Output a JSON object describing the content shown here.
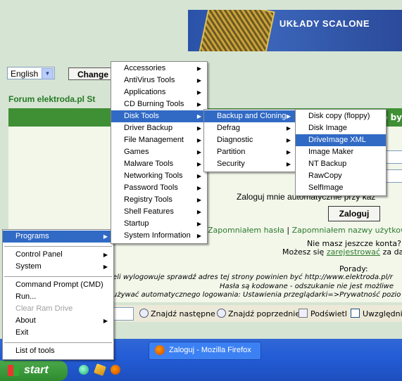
{
  "banner": {
    "text": "UKŁADY SCALONE"
  },
  "language": {
    "value": "English",
    "change_label": "Change"
  },
  "forum": {
    "title": "Forum elektroda.pl St",
    "bar_end": "o by",
    "auto_login": "Zaloguj mnie automatycznie przy każ",
    "login_button": "Zaloguj",
    "forgot_password": "Zapomniałem hasła",
    "separator": "|",
    "forgot_username": "Zapomniałem nazwy użytkow",
    "no_account": "Nie masz jeszcze konta?",
    "register_pre": "Możesz się",
    "register_link": "zarejestrować",
    "register_post": "za da",
    "tips_title": "Porady:",
    "tip1": "eli wylogowuje sprawdź adres tej strony powinien być http://www.elektroda.pl/r",
    "tip2": "Hasła są kodowane - odszukanie nie jest możliwe",
    "tip3": "używać automatycznego logowania: Ustawienia przeglądarki=>Prywatność pozio"
  },
  "findbar": {
    "next": "Znajdź następne",
    "prev": "Znajdź poprzednie",
    "highlight": "Podświetl",
    "match_case": "Uwzględnij"
  },
  "taskbar": {
    "start": "start",
    "window_title": "Zaloguj - Mozilla Firefox"
  },
  "menus": {
    "main": [
      {
        "label": "Programs",
        "arrow": "▶",
        "highlighted": true
      },
      {
        "label": "Control Panel",
        "arrow": "▶"
      },
      {
        "label": "System",
        "arrow": "▶"
      },
      {
        "label": "Command Prompt (CMD)"
      },
      {
        "label": "Run..."
      },
      {
        "label": "Clear Ram Drive",
        "disabled": true
      },
      {
        "label": "About",
        "arrow": "▶"
      },
      {
        "label": "Exit"
      },
      {
        "label": "List of tools"
      }
    ],
    "programs": [
      {
        "label": "Accessories",
        "arrow": "▶"
      },
      {
        "label": "AntiVirus Tools",
        "arrow": "▶"
      },
      {
        "label": "Applications",
        "arrow": "▶"
      },
      {
        "label": "CD Burning Tools",
        "arrow": "▶"
      },
      {
        "label": "Disk Tools",
        "arrow": "▶",
        "highlighted": true
      },
      {
        "label": "Driver Backup",
        "arrow": "▶"
      },
      {
        "label": "File Management",
        "arrow": "▶"
      },
      {
        "label": "Games",
        "arrow": "▶"
      },
      {
        "label": "Malware Tools",
        "arrow": "▶"
      },
      {
        "label": "Networking Tools",
        "arrow": "▶"
      },
      {
        "label": "Password Tools",
        "arrow": "▶"
      },
      {
        "label": "Registry Tools",
        "arrow": "▶"
      },
      {
        "label": "Shell Features",
        "arrow": "▶"
      },
      {
        "label": "Startup",
        "arrow": "▶"
      },
      {
        "label": "System Information",
        "arrow": "▶"
      }
    ],
    "disk_tools": [
      {
        "label": "Backup and Cloning",
        "arrow": "▶",
        "highlighted": true
      },
      {
        "label": "Defrag",
        "arrow": "▶"
      },
      {
        "label": "Diagnostic",
        "arrow": "▶"
      },
      {
        "label": "Partition",
        "arrow": "▶"
      },
      {
        "label": "Security",
        "arrow": "▶"
      }
    ],
    "backup_cloning": [
      {
        "label": "Disk copy (floppy)"
      },
      {
        "label": "Disk Image"
      },
      {
        "label": "DriveImage XML",
        "highlighted": true
      },
      {
        "label": "Image Maker"
      },
      {
        "label": "NT Backup"
      },
      {
        "label": "RawCopy"
      },
      {
        "label": "SelfImage"
      }
    ]
  }
}
